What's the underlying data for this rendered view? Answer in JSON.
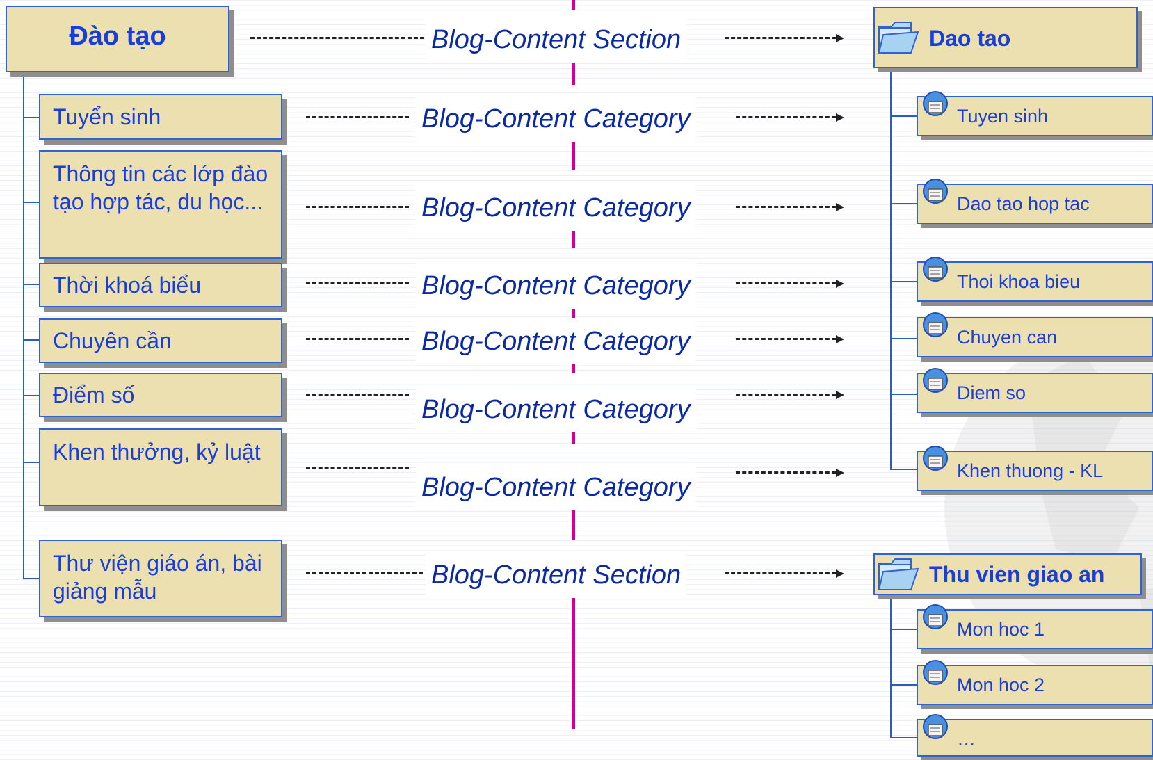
{
  "left": {
    "main": "Đào tạo",
    "items": [
      "Tuyển sinh",
      "Thông tin các lớp đào tạo hợp tác, du học...",
      "Thời khoá biểu",
      "Chuyên cần",
      "Điểm số",
      "Khen thưởng, kỷ luật",
      "Thư viện giáo án, bài giảng mẫu"
    ]
  },
  "middle": {
    "labels": [
      "Blog-Content Section",
      "Blog-Content Category",
      "Blog-Content Category",
      "Blog-Content Category",
      "Blog-Content Category",
      "Blog-Content Category",
      "Blog-Content Category",
      "Blog-Content Section"
    ]
  },
  "right": {
    "section1": {
      "title": "Dao tao",
      "items": [
        "Tuyen sinh",
        "Dao tao hop tac",
        "Thoi khoa bieu",
        "Chuyen can",
        "Diem so",
        "Khen thuong - KL"
      ]
    },
    "section2": {
      "title": "Thu vien giao an",
      "items": [
        "Mon hoc 1",
        "Mon hoc 2",
        "…"
      ]
    }
  },
  "colors": {
    "box_fill": "#ecdfb0",
    "border_blue": "#2f64d0",
    "text_blue": "#1a3fd6",
    "label_blue": "#0c2aa0",
    "magenta": "#cc0099"
  },
  "icons": [
    "folder-icon",
    "page-icon",
    "globe-watermark"
  ]
}
